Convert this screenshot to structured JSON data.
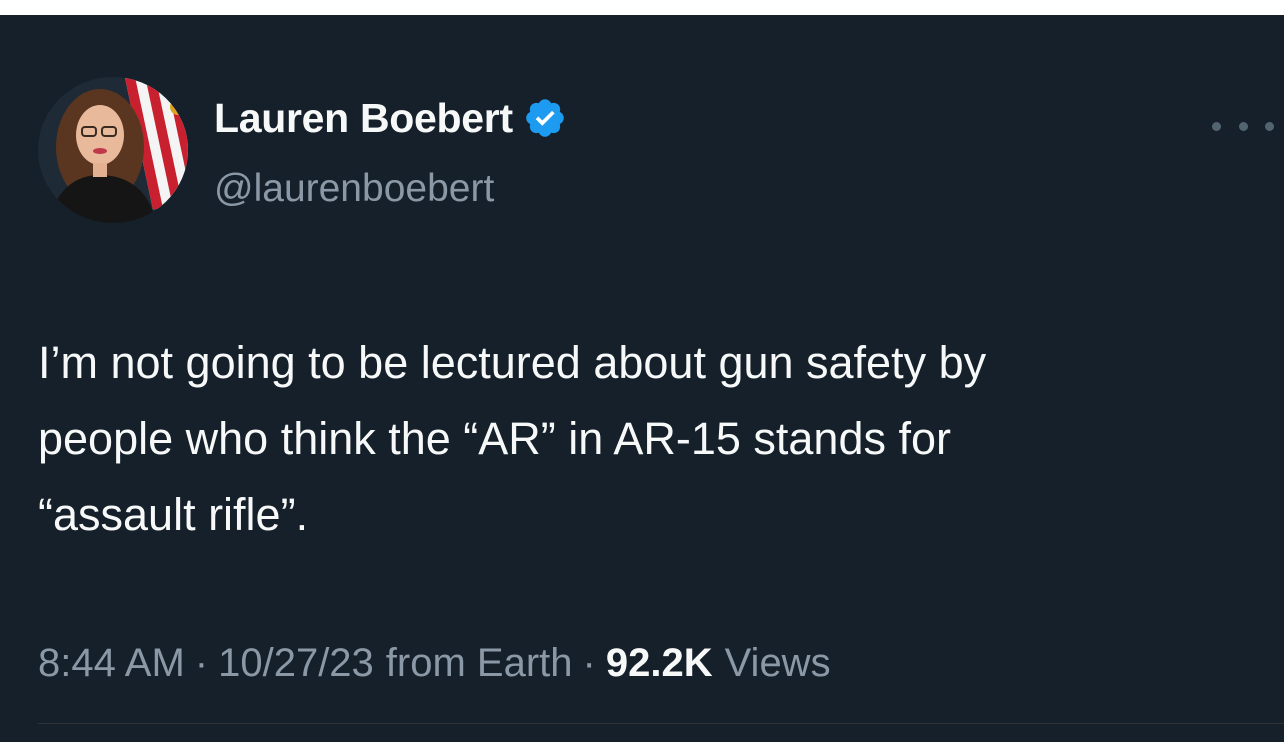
{
  "author": {
    "display_name": "Lauren Boebert",
    "handle": "@laurenboebert",
    "verified": true
  },
  "tweet": {
    "text": "I’m not going to be lectured about gun safety by\npeople who think the “AR” in AR-15 stands for\n“assault rifle”.",
    "time": "8:44 AM",
    "date": "10/27/23",
    "source": "from Earth",
    "separator": "·",
    "views_count": "92.2K",
    "views_label": "Views"
  },
  "icons": {
    "verified": "verified-badge-icon",
    "more": "more-options-icon"
  },
  "colors": {
    "background": "#15202b",
    "primary_text": "#f7f9f9",
    "secondary_text": "#8b98a5",
    "verified_blue": "#1d9bf0"
  }
}
